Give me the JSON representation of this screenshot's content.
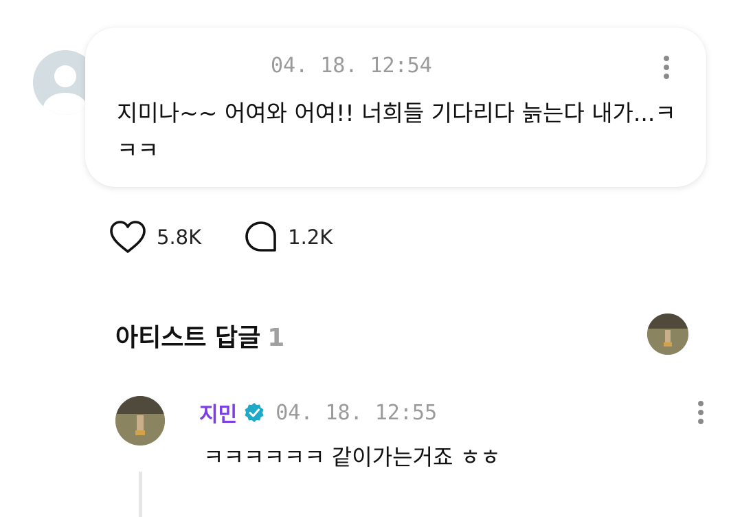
{
  "post": {
    "timestamp": "04. 18. 12:54",
    "text": "지미나~~ 어여와 어여!!  너희들 기다리다 늙는다 내가...ㅋㅋㅋ",
    "avatar_icon": "default-user-icon",
    "more_icon": "more-vertical-icon"
  },
  "actions": {
    "like_icon": "heart-icon",
    "like_count": "5.8K",
    "comment_icon": "comment-bubble-icon",
    "comment_count": "1.2K"
  },
  "artist_replies": {
    "title": "아티스트 답글",
    "count": "1"
  },
  "reply": {
    "author": "지민",
    "verified_icon": "verified-badge-icon",
    "timestamp": "04. 18. 12:55",
    "text": "ㅋㅋㅋㅋㅋㅋ 같이가는거죠 ㅎㅎ",
    "more_icon": "more-vertical-icon"
  },
  "colors": {
    "author_name": "#7b3fe4",
    "verified_badge": "#1fa9c9",
    "timestamp": "#9a9a9a",
    "count_muted": "#a0a0a0"
  }
}
